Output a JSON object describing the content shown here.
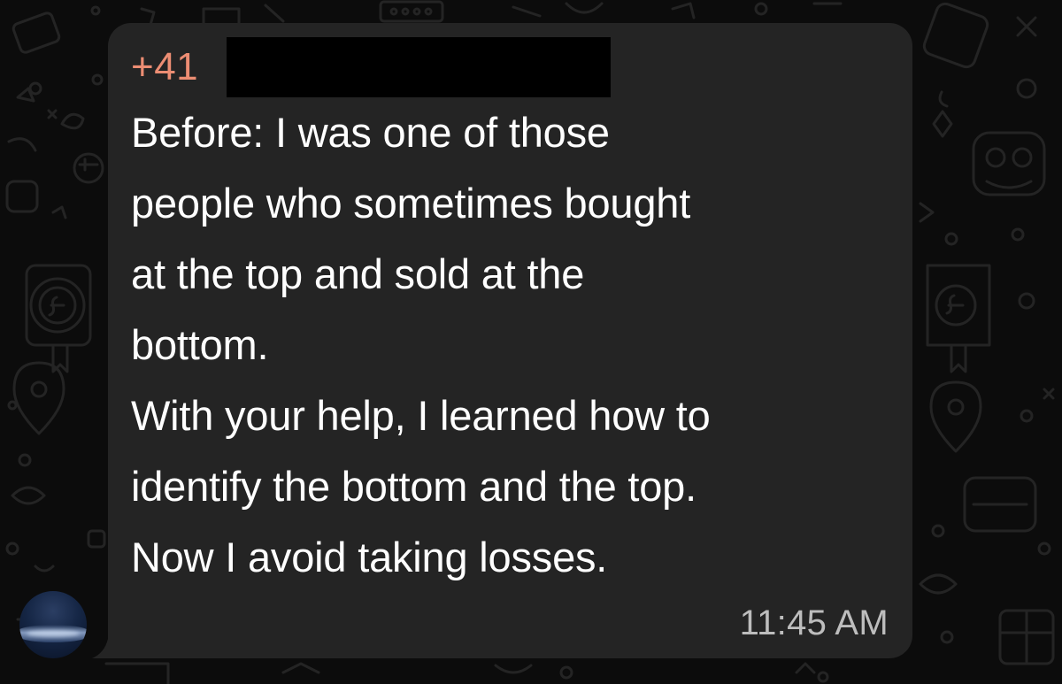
{
  "chat": {
    "background_color": "#0c0c0c",
    "bubble_color": "#242424",
    "message": {
      "sender": "+41",
      "sender_color": "#ec8d73",
      "sender_detail_redacted": true,
      "lines": [
        "Before: I was one of those",
        "people who sometimes bought",
        "at the top and sold at the",
        "bottom.",
        "With your help, I learned how to",
        "identify the bottom and the top.",
        "Now I avoid taking losses."
      ],
      "time": "11:45 AM"
    },
    "avatar": {
      "icon": "earth-from-space-avatar"
    }
  }
}
